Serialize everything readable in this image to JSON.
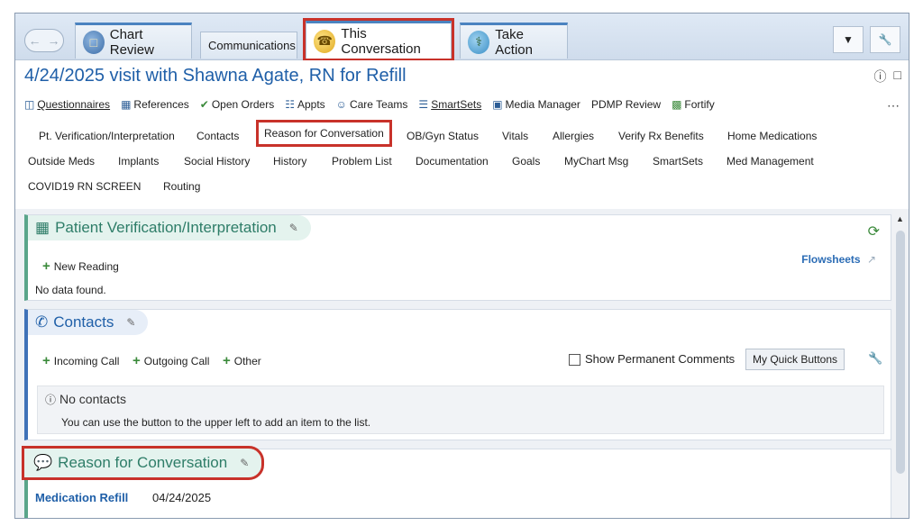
{
  "tabs": {
    "chart_review": "Chart Review",
    "communications": "Communications",
    "this_conversation": "This Conversation",
    "take_action": "Take Action"
  },
  "header": {
    "title": "4/24/2025 visit with Shawna Agate, RN for Refill"
  },
  "toolbar": [
    {
      "label": "Questionnaires",
      "icon": "questionnaire-icon"
    },
    {
      "label": "References",
      "icon": "references-icon"
    },
    {
      "label": "Open Orders",
      "icon": "checkmark-icon"
    },
    {
      "label": "Appts",
      "icon": "appts-icon"
    },
    {
      "label": "Care Teams",
      "icon": "care-teams-icon"
    },
    {
      "label": "SmartSets",
      "icon": "smartsets-icon"
    },
    {
      "label": "Media Manager",
      "icon": "media-manager-icon"
    },
    {
      "label": "PDMP Review",
      "icon": ""
    },
    {
      "label": "Fortify",
      "icon": "fortify-icon"
    }
  ],
  "nav_row1": [
    "Pt. Verification/Interpretation",
    "Contacts",
    "Reason for Conversation",
    "OB/Gyn Status",
    "Vitals",
    "Allergies",
    "Verify Rx Benefits",
    "Home Medications"
  ],
  "nav_row2": [
    "Outside Meds",
    "Implants",
    "Social History",
    "History",
    "Problem List",
    "Documentation",
    "Goals",
    "MyChart Msg",
    "SmartSets",
    "Med Management"
  ],
  "nav_row3": [
    "COVID19 RN SCREEN",
    "Routing"
  ],
  "pt_verification": {
    "title": "Patient Verification/Interpretation",
    "new_reading": "New Reading",
    "no_data": "No data found.",
    "flowsheets": "Flowsheets"
  },
  "contacts": {
    "title": "Contacts",
    "incoming": "Incoming Call",
    "outgoing": "Outgoing Call",
    "other": "Other",
    "show_permanent": "Show Permanent Comments",
    "quick_buttons": "My Quick Buttons",
    "no_contacts": "No contacts",
    "hint": "You can use the button to the upper left to add an item to the list."
  },
  "reason": {
    "title": "Reason for Conversation",
    "item": "Medication Refill",
    "date": "04/24/2025"
  },
  "colors": {
    "accent_blue": "#1f5fa8",
    "highlight_red": "#c8322a",
    "teal": "#2e7d68"
  }
}
